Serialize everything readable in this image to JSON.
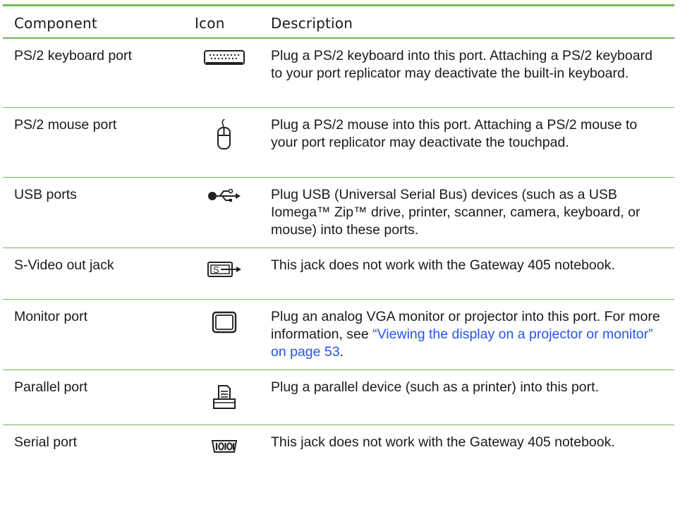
{
  "table": {
    "headers": {
      "component": "Component",
      "icon": "Icon",
      "description": "Description"
    },
    "rows": [
      {
        "component": "PS/2 keyboard port",
        "icon": "keyboard-icon",
        "description": "Plug a PS/2 keyboard into this port. Attaching a PS/2 keyboard to your port replicator may deactivate the built-in keyboard."
      },
      {
        "component": "PS/2 mouse port",
        "icon": "mouse-icon",
        "description": "Plug a PS/2 mouse into this port. Attaching a PS/2 mouse to your port replicator may deactivate the touchpad."
      },
      {
        "component": "USB ports",
        "icon": "usb-icon",
        "description": "Plug USB (Universal Serial Bus) devices (such as a USB Iomega™ Zip™ drive, printer, scanner, camera, keyboard, or mouse) into these ports."
      },
      {
        "component": "S-Video out jack",
        "icon": "s-video-icon",
        "description": "This jack does not work with the Gateway 405 notebook."
      },
      {
        "component": "Monitor port",
        "icon": "monitor-icon",
        "description_pre": "Plug an analog VGA monitor or projector into this port. For more information, see ",
        "description_link": "“Viewing the display on a projector or monitor” on page 53",
        "description_post": "."
      },
      {
        "component": "Parallel port",
        "icon": "printer-icon",
        "description": "Plug a parallel device (such as a printer) into this port."
      },
      {
        "component": "Serial port",
        "icon": "serial-icon",
        "description": "This jack does not work with the Gateway 405 notebook."
      }
    ]
  },
  "colors": {
    "rule": "#6dbb5a",
    "link": "#2455e6",
    "text": "#1a1a1a"
  }
}
